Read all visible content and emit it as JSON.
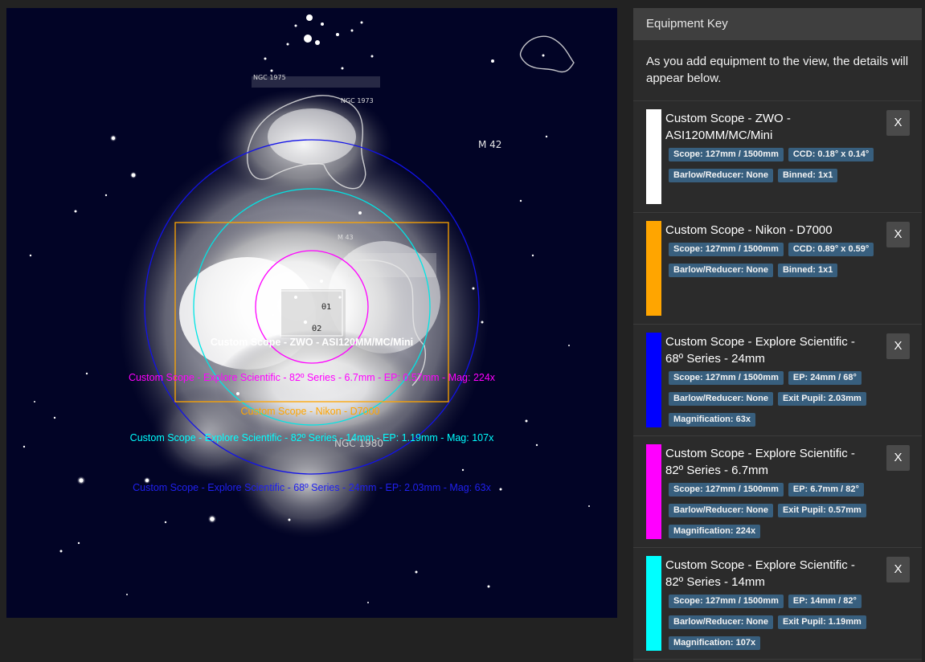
{
  "sky": {
    "labels": {
      "ngc1975": "NGC 1975",
      "ngc1973": "NGC 1973",
      "m42": "M 42",
      "m43": "M 43",
      "ngc1980": "NGC 1980",
      "theta1": "θ1",
      "beta2": "θ2"
    },
    "overlays": [
      {
        "label": "Custom Scope - ZWO - ASI120MM/MC/Mini",
        "color": "#ffffff"
      },
      {
        "label": "Custom Scope - Explore Scientific - 82º Series - 6.7mm - EP: 0.57mm - Mag: 224x",
        "color": "#ff00ff"
      },
      {
        "label": "Custom Scope - Nikon - D7000",
        "color": "#ffa500"
      },
      {
        "label": "Custom Scope - Explore Scientific - 82º Series - 14mm - EP: 1.19mm - Mag: 107x",
        "color": "#00ffff"
      },
      {
        "label": "Custom Scope - Explore Scientific - 68º Series - 24mm - EP: 2.03mm - Mag: 63x",
        "color": "#0000ff"
      }
    ]
  },
  "panel": {
    "title": "Equipment Key",
    "intro": "As you add equipment to the view, the details will appear below.",
    "remove_label": "X",
    "items": [
      {
        "title": "Custom Scope - ZWO - ASI120MM/MC/Mini",
        "color": "#ffffff",
        "badges": [
          "Scope: 127mm / 1500mm",
          "CCD: 0.18° x 0.14°",
          "Barlow/Reducer: None",
          "Binned: 1x1"
        ]
      },
      {
        "title": "Custom Scope - Nikon - D7000",
        "color": "#ffa500",
        "badges": [
          "Scope: 127mm / 1500mm",
          "CCD: 0.89° x 0.59°",
          "Barlow/Reducer: None",
          "Binned: 1x1"
        ]
      },
      {
        "title": "Custom Scope - Explore Scientific - 68º Series - 24mm",
        "color": "#0000ff",
        "badges": [
          "Scope: 127mm / 1500mm",
          "EP: 24mm / 68°",
          "Barlow/Reducer: None",
          "Exit Pupil: 2.03mm",
          "Magnification: 63x"
        ]
      },
      {
        "title": "Custom Scope - Explore Scientific - 82º Series - 6.7mm",
        "color": "#ff00ff",
        "badges": [
          "Scope: 127mm / 1500mm",
          "EP: 6.7mm / 82°",
          "Barlow/Reducer: None",
          "Exit Pupil: 0.57mm",
          "Magnification: 224x"
        ]
      },
      {
        "title": "Custom Scope - Explore Scientific - 82º Series - 14mm",
        "color": "#00ffff",
        "badges": [
          "Scope: 127mm / 1500mm",
          "EP: 14mm / 82°",
          "Barlow/Reducer: None",
          "Exit Pupil: 1.19mm",
          "Magnification: 107x"
        ]
      }
    ]
  }
}
